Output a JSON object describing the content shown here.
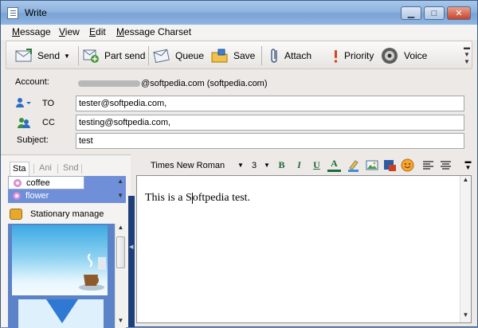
{
  "window": {
    "title": "Write"
  },
  "menu": [
    "Message",
    "View",
    "Edit",
    "Message Charset"
  ],
  "toolbar": {
    "send": "Send",
    "part_send": "Part send",
    "queue": "Queue",
    "save": "Save",
    "attach": "Attach",
    "priority": "Priority",
    "voice": "Voice"
  },
  "header": {
    "account_label": "Account:",
    "account_value": "@softpedia.com  (softpedia.com)",
    "to_label": "TO",
    "to_value": "tester@softpedia.com,",
    "cc_label": "CC",
    "cc_value": "testing@softpedia.com,",
    "subject_label": "Subject:",
    "subject_value": "test"
  },
  "left_panel": {
    "tabs": [
      "Sta",
      "Ani",
      "Snd"
    ],
    "stationery_items": [
      "coffee",
      "flower"
    ],
    "stationary_manage": "Stationary manage"
  },
  "format": {
    "font": "Times New Roman",
    "size": "3"
  },
  "editor": {
    "text_before_caret": "This is a S",
    "text_after_caret": "oftpedia test."
  },
  "colors": {
    "accent": "#6f8fd8",
    "splitter": "#1e3f7a"
  }
}
